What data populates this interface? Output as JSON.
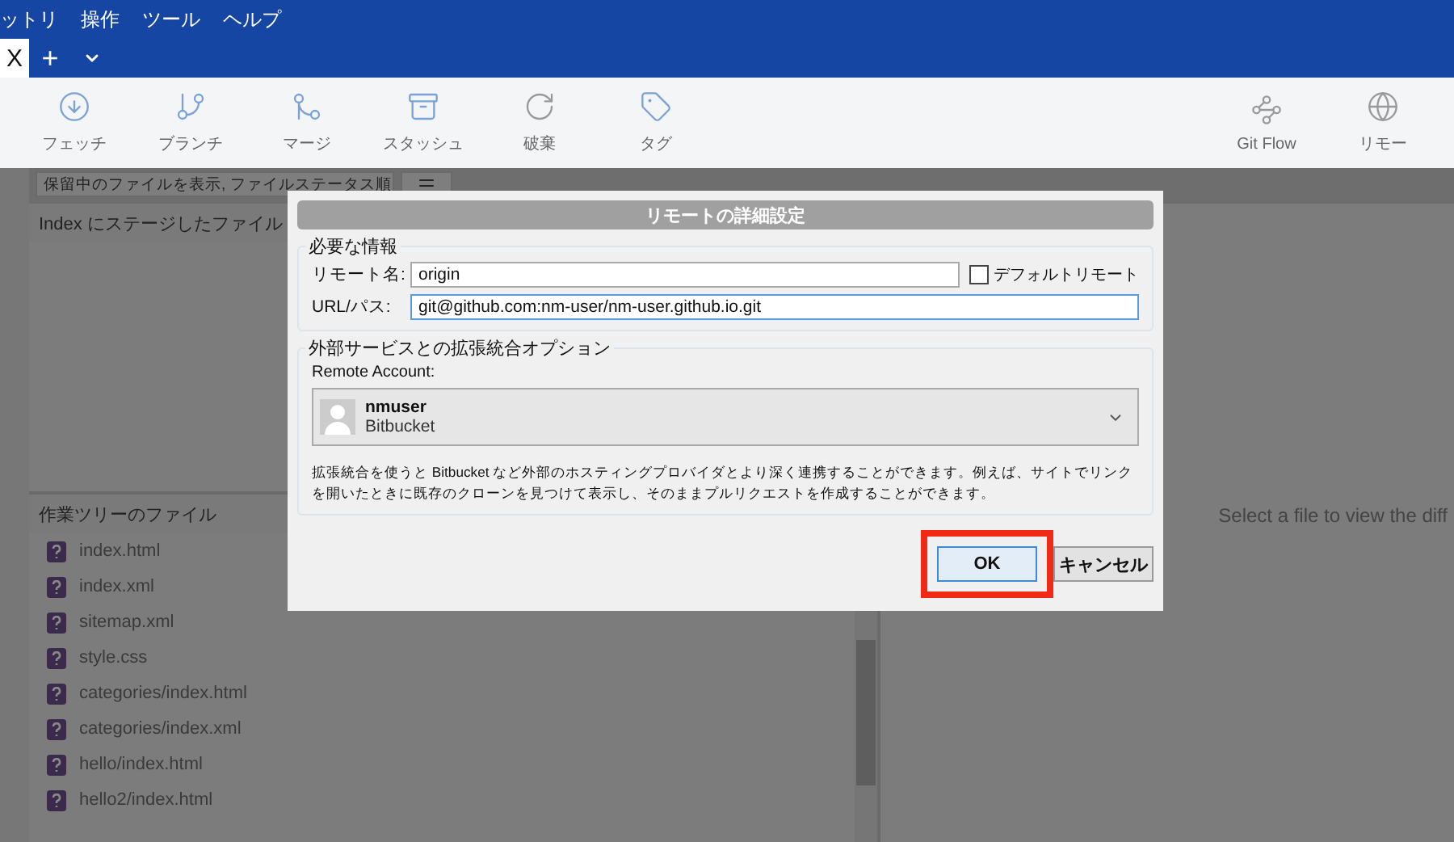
{
  "menu": [
    "ットリ",
    "操作",
    "ツール",
    "ヘルプ"
  ],
  "tab_bar": {
    "close": "X",
    "add": "+"
  },
  "toolbar": {
    "left": [
      {
        "kind": "fetch",
        "label": "フェッチ"
      },
      {
        "kind": "branch",
        "label": "ブランチ"
      },
      {
        "kind": "merge",
        "label": "マージ"
      },
      {
        "kind": "stash",
        "label": "スタッシュ"
      },
      {
        "kind": "discard",
        "label": "破棄"
      },
      {
        "kind": "tag",
        "label": "タグ"
      }
    ],
    "right": [
      {
        "kind": "flow",
        "label": "Git Flow"
      },
      {
        "kind": "remote",
        "label": "リモー"
      }
    ]
  },
  "filter": {
    "value": "保留中のファイルを表示, ファイルステータス順"
  },
  "staged_panel": {
    "title": "Index にステージしたファイル"
  },
  "working_panel": {
    "title": "作業ツリーのファイル",
    "files": [
      "index.html",
      "index.xml",
      "sitemap.xml",
      "style.css",
      "categories/index.html",
      "categories/index.xml",
      "hello/index.html",
      "hello2/index.html"
    ]
  },
  "diff_placeholder": "Select a file to view the diff",
  "dialog": {
    "title": "リモートの詳細設定",
    "required_group": {
      "title": "必要な情報",
      "name_label": "リモート名:",
      "name_value": "origin",
      "default_label": "デフォルトリモート",
      "default_checked": false,
      "url_label": "URL/パス:",
      "url_value": "git@github.com:nm-user/nm-user.github.io.git"
    },
    "integration_group": {
      "title": "外部サービスとの拡張統合オプション",
      "account_label": "Remote Account:",
      "account_name": "nmuser",
      "account_service": "Bitbucket",
      "description": "拡張統合を使うと Bitbucket など外部のホスティングプロバイダとより深く連携することができます。例えば、サイトでリンクを開いたときに既存のクローンを見つけて表示し、そのままプルリクエストを作成することができます。"
    },
    "buttons": [
      {
        "label": "OK",
        "highlighted": true
      },
      {
        "label": "キャンセル",
        "highlighted": false
      }
    ]
  }
}
